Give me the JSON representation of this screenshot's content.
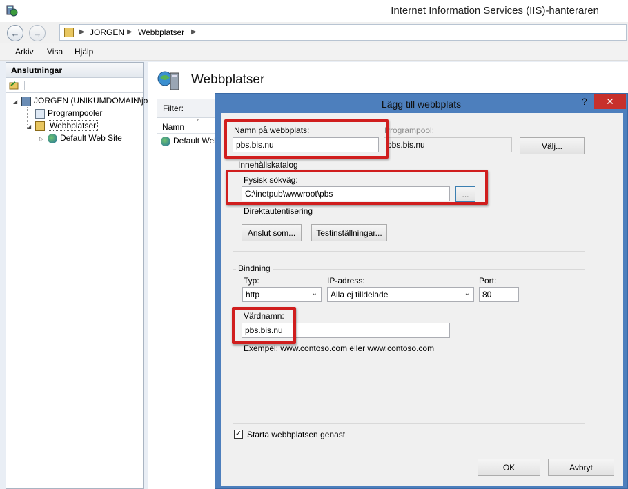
{
  "window": {
    "title": "Internet Information Services (IIS)-hanteraren"
  },
  "address": {
    "crumbs": [
      "JORGEN",
      "Webbplatser"
    ]
  },
  "menu": {
    "items": [
      "Arkiv",
      "Visa",
      "Hjälp"
    ]
  },
  "connections": {
    "header": "Anslutningar",
    "tree": [
      {
        "label": "JORGEN (UNIKUMDOMAIN\\jo"
      },
      {
        "label": "Programpooler"
      },
      {
        "label": "Webbplatser"
      },
      {
        "label": "Default Web Site"
      }
    ]
  },
  "content": {
    "title": "Webbplatser",
    "filter_label": "Filter:",
    "column_name": "Namn",
    "rows": [
      "Default Web"
    ]
  },
  "dialog": {
    "title": "Lägg till webbplats",
    "help": "?",
    "close": "✕",
    "site_name_label": "Namn på webbplats:",
    "site_name_value": "pbs.bis.nu",
    "app_pool_label": "Programpool:",
    "app_pool_value": "pbs.bis.nu",
    "select_button": "Välj...",
    "content_dir_group": "Innehållskatalog",
    "physical_path_label": "Fysisk sökväg:",
    "physical_path_value": "C:\\inetpub\\wwwroot\\pbs",
    "browse_button": "...",
    "passthrough_label": "Direktautentisering",
    "connect_as_button": "Anslut som...",
    "test_settings_button": "Testinställningar...",
    "binding_group": "Bindning",
    "type_label": "Typ:",
    "type_value": "http",
    "ip_label": "IP-adress:",
    "ip_value": "Alla ej tilldelade",
    "port_label": "Port:",
    "port_value": "80",
    "host_label": "Värdnamn:",
    "host_value": "pbs.bis.nu",
    "example_text": "Exempel: www.contoso.com eller www.contoso.com",
    "start_checkbox_label": "Starta webbplatsen genast",
    "start_checked": true,
    "ok_button": "OK",
    "cancel_button": "Avbryt"
  },
  "colors": {
    "highlight_red": "#d01e1e",
    "dialog_frame": "#4d7fbd",
    "close_red": "#c7302b"
  }
}
